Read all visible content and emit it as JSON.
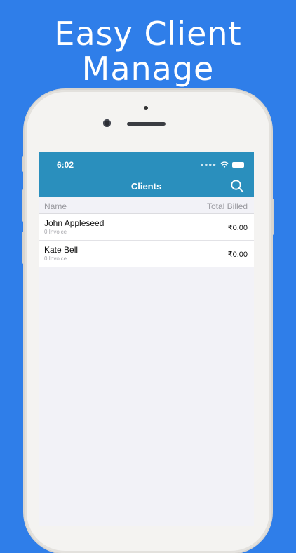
{
  "promo": {
    "line1": "Easy Client",
    "line2": "Manage"
  },
  "status_bar": {
    "time": "6:02",
    "icons": [
      "signal-dots-icon",
      "wifi-icon",
      "battery-icon"
    ]
  },
  "navbar": {
    "title": "Clients",
    "search_icon": "search-icon",
    "background": "#2a8fbd"
  },
  "columns": {
    "name": "Name",
    "total_billed": "Total Billed"
  },
  "clients": [
    {
      "name": "John Appleseed",
      "invoices": "0 Invoice",
      "total": "₹0.00"
    },
    {
      "name": "Kate Bell",
      "invoices": "0 Invoice",
      "total": "₹0.00"
    }
  ],
  "colors": {
    "page_background": "#2f7ee9",
    "accent": "#2a8fbd"
  }
}
